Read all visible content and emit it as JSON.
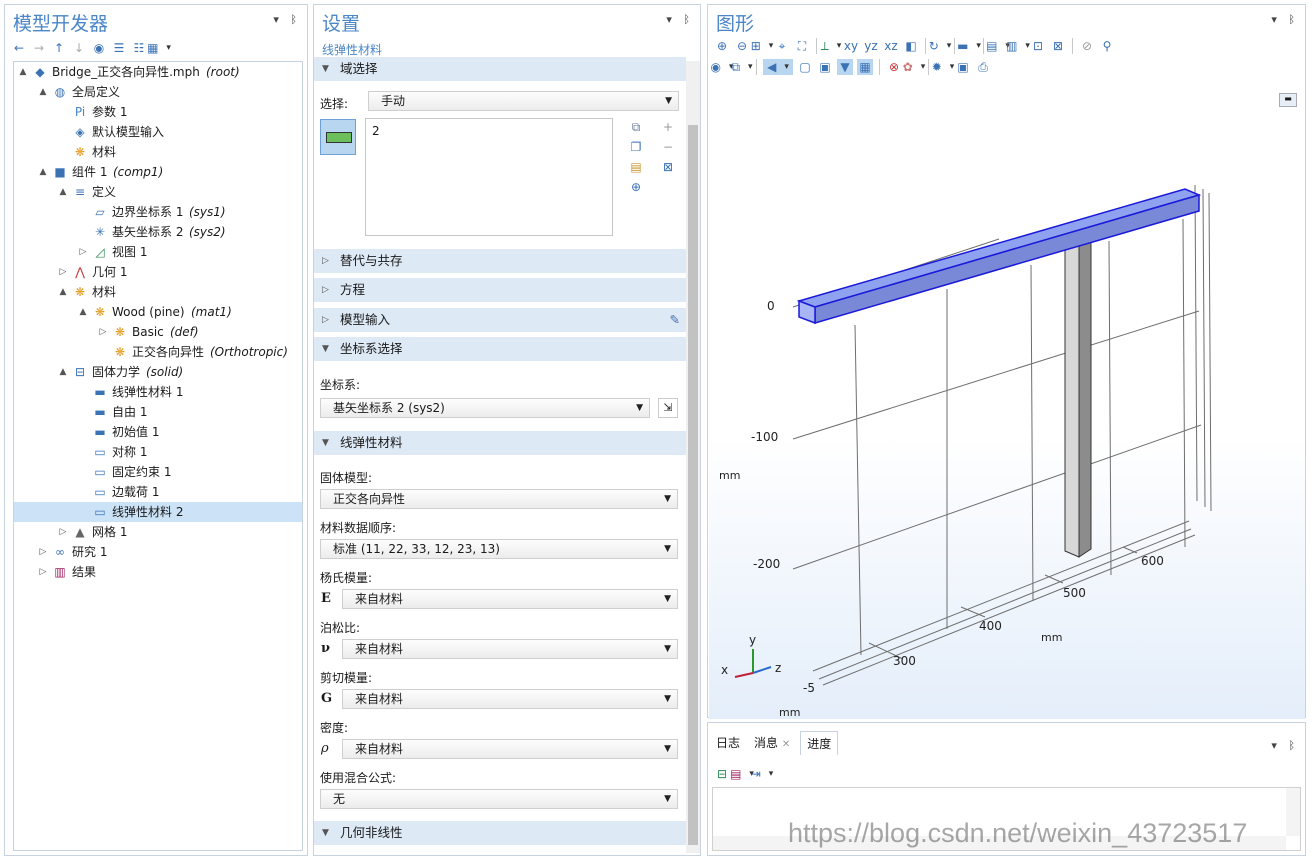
{
  "model_builder": {
    "title": "模型开发器",
    "tree": [
      {
        "label": "Bridge_正交各向异性.mph",
        "tag": "(root)",
        "icon": "model-icon"
      },
      {
        "label": "全局定义",
        "tag": "",
        "icon": "globe-icon"
      },
      {
        "label": "参数 1",
        "tag": "",
        "icon": "parameters-icon"
      },
      {
        "label": "默认模型输入",
        "tag": "",
        "icon": "model-input-icon"
      },
      {
        "label": "材料",
        "tag": "",
        "icon": "materials-icon"
      },
      {
        "label": "组件 1",
        "tag": "(comp1)",
        "icon": "component-icon"
      },
      {
        "label": "定义",
        "tag": "",
        "icon": "definitions-icon"
      },
      {
        "label": "边界坐标系 1",
        "tag": "(sys1)",
        "icon": "boundary-system-icon"
      },
      {
        "label": "基矢坐标系 2",
        "tag": "(sys2)",
        "icon": "base-vector-system-icon"
      },
      {
        "label": "视图 1",
        "tag": "",
        "icon": "view-icon"
      },
      {
        "label": "几何 1",
        "tag": "",
        "icon": "geometry-icon"
      },
      {
        "label": "材料",
        "tag": "",
        "icon": "materials-icon"
      },
      {
        "label": "Wood (pine)",
        "tag": "(mat1)",
        "icon": "material-icon"
      },
      {
        "label": "Basic",
        "tag": "(def)",
        "icon": "material-icon"
      },
      {
        "label": "正交各向异性",
        "tag": "(Orthotropic)",
        "icon": "material-icon"
      },
      {
        "label": "固体力学",
        "tag": "(solid)",
        "icon": "solid-mechanics-icon"
      },
      {
        "label": "线弹性材料 1",
        "tag": "",
        "icon": "linear-elastic-icon"
      },
      {
        "label": "自由 1",
        "tag": "",
        "icon": "free-icon"
      },
      {
        "label": "初始值 1",
        "tag": "",
        "icon": "initial-values-icon"
      },
      {
        "label": "对称 1",
        "tag": "",
        "icon": "symmetry-icon"
      },
      {
        "label": "固定约束 1",
        "tag": "",
        "icon": "fixed-constraint-icon"
      },
      {
        "label": "边载荷 1",
        "tag": "",
        "icon": "edge-load-icon"
      },
      {
        "label": "线弹性材料 2",
        "tag": "",
        "icon": "linear-elastic-icon"
      },
      {
        "label": "网格 1",
        "tag": "",
        "icon": "mesh-icon"
      },
      {
        "label": "研究 1",
        "tag": "",
        "icon": "study-icon"
      },
      {
        "label": "结果",
        "tag": "",
        "icon": "results-icon"
      }
    ]
  },
  "settings": {
    "title": "设置",
    "subtitle": "线弹性材料",
    "sections": {
      "domain_selection": "域选择",
      "override": "替代与共存",
      "equation": "方程",
      "model_input": "模型输入",
      "coord_selection": "坐标系选择",
      "linear_elastic": "线弹性材料",
      "geom_nonlinearity": "几何非线性"
    },
    "selection_label": "选择:",
    "selection_value": "手动",
    "selection_list": [
      "2"
    ],
    "coord_label": "坐标系:",
    "coord_value": "基矢坐标系 2 (sys2)",
    "solid_model_label": "固体模型:",
    "solid_model_value": "正交各向异性",
    "data_order_label": "材料数据顺序:",
    "data_order_value": "标准 (11, 22, 33, 12, 23, 13)",
    "youngs_label": "杨氏模量:",
    "youngs_symbol": "E",
    "youngs_value": "来自材料",
    "poisson_label": "泊松比:",
    "poisson_symbol": "ν",
    "poisson_value": "来自材料",
    "shear_label": "剪切模量:",
    "shear_symbol": "G",
    "shear_value": "来自材料",
    "density_label": "密度:",
    "density_symbol": "ρ",
    "density_value": "来自材料",
    "mixing_label": "使用混合公式:",
    "mixing_value": "无"
  },
  "graphics": {
    "title": "图形",
    "axis_labels": {
      "y0": "0",
      "y100": "-100",
      "y200": "-200",
      "ymm": "mm",
      "z300": "300",
      "z400": "400",
      "z500": "500",
      "z600": "600",
      "zmm": "mm",
      "xm5": "-5",
      "xmm": "mm"
    },
    "triad": {
      "x": "x",
      "y": "y",
      "z": "z"
    }
  },
  "bottom_panel": {
    "tabs": [
      "日志",
      "消息",
      "进度"
    ]
  },
  "watermark": "https://blog.csdn.net/weixin_43723517"
}
